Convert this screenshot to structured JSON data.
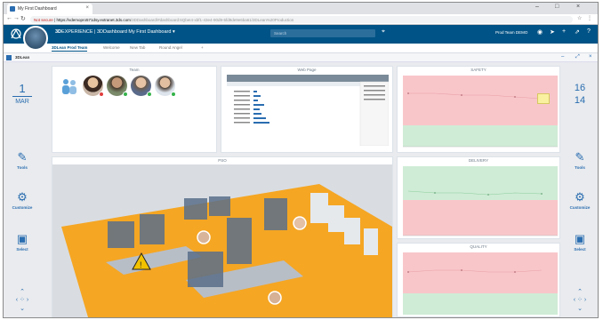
{
  "browser": {
    "tab_title": "My First Dashboard",
    "url_security": "Not secure",
    "url_host": "https://vdemopro571dsy.extranet.3ds.com",
    "url_path": "/3DDashboard/#dashboard:6QbeI4-xbf1-43e4-90d9-5fd9de9e6ba61/3DLean%20Production"
  },
  "app": {
    "title_bold": "3D",
    "title_rest": "EXPERIENCE | 3DDashboard My First Dashboard",
    "search_placeholder": "Search",
    "team_label": "Prod Team DEMO"
  },
  "tabs": [
    {
      "label": "3DLean Prod Team"
    },
    {
      "label": "Welcome"
    },
    {
      "label": "New Tab"
    },
    {
      "label": "Round Angel"
    },
    {
      "label": "+"
    }
  ],
  "subheader": {
    "label": "3DLean"
  },
  "left_panel": {
    "date_day": "1",
    "date_month": "MAR",
    "buttons": [
      {
        "label": "Tools",
        "icon": "pencil-icon"
      },
      {
        "label": "Customize",
        "icon": "gear-icon"
      },
      {
        "label": "Select",
        "icon": "select-icon"
      }
    ]
  },
  "right_panel": {
    "num_top": "16",
    "num_bottom": "14",
    "buttons": [
      {
        "label": "Tools",
        "icon": "pencil-icon"
      },
      {
        "label": "Customize",
        "icon": "gear-icon"
      },
      {
        "label": "Select",
        "icon": "select-icon"
      }
    ]
  },
  "widgets": {
    "team": {
      "title": "Team"
    },
    "webpage": {
      "title": "Web Page"
    },
    "safety": {
      "title": "SAFETY"
    },
    "floor": {
      "title": "PSO"
    },
    "delivery": {
      "title": "DELIVERY"
    },
    "quality": {
      "title": "QUALITY"
    }
  },
  "colors": {
    "header": "#005386",
    "accent": "#2a6db0",
    "chart_red": "#f8c6c9",
    "chart_green": "#cfecd6",
    "floor_orange": "#f5a623"
  }
}
